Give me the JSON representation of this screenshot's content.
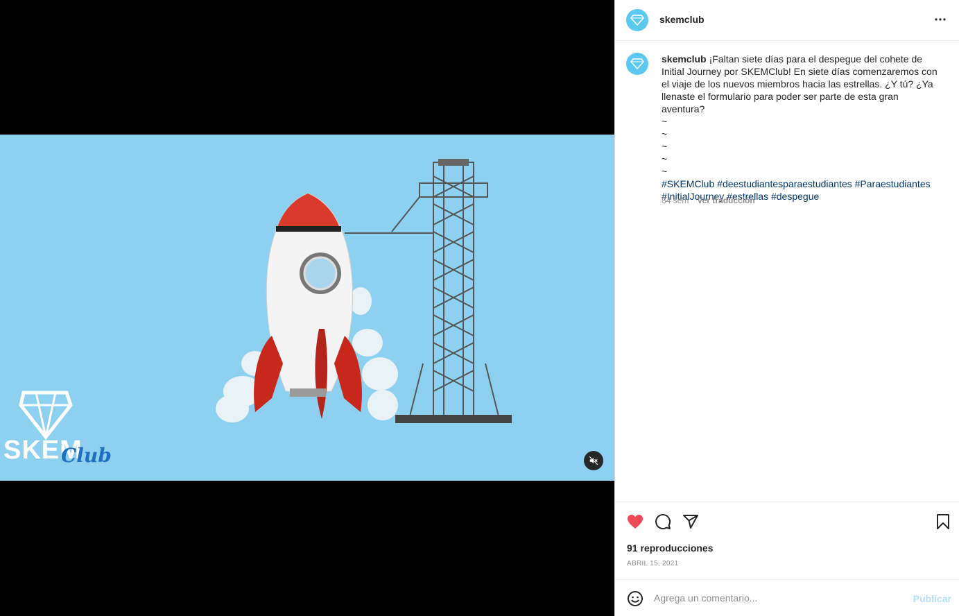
{
  "post": {
    "username": "skemclub",
    "caption_text": "¡Faltan siete días para el despegue del cohete de Initial Journey por SKEMClub! En siete días comenzaremos con el viaje de los nuevos miembros hacia las estrellas. ¿Y tú? ¿Ya llenaste el formulario para poder ser parte de esta gran aventura?",
    "tildes": [
      "~",
      "~",
      "~",
      "~",
      "~"
    ],
    "hashtags": [
      "#SKEMClub",
      "#deestudiantesparaestudiantes",
      "#Paraestudiantes",
      "#InitialJourney",
      "#estrellas",
      "#despegue"
    ],
    "age": "84 sem",
    "translate_label": "Ver traducción",
    "views": "91 reproducciones",
    "date": "ABRIL 15, 2021",
    "liked": true
  },
  "video": {
    "logo_word": "SKEM",
    "logo_script": "Club",
    "muted": true,
    "background_color": "#8ed0f0"
  },
  "comment_box": {
    "placeholder": "Agrega un comentario...",
    "publish_label": "Publicar"
  },
  "colors": {
    "like": "#ed4956",
    "link": "#00376b",
    "publish_disabled": "#b2dffc",
    "avatar": "#5bc8ef"
  },
  "icons": [
    "more-options-icon",
    "heart-icon",
    "comment-icon",
    "share-icon",
    "bookmark-icon",
    "mute-icon",
    "emoji-icon"
  ]
}
